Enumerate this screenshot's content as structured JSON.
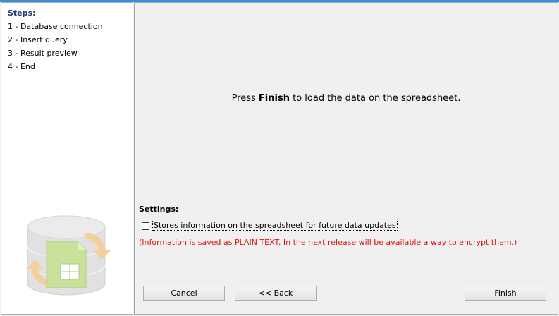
{
  "steps": {
    "title": "Steps:",
    "items": [
      "1 - Database connection",
      "2 - Insert query",
      "3 - Result preview",
      "4 - End"
    ]
  },
  "main": {
    "message_prefix": "Press ",
    "message_bold": "Finish",
    "message_suffix": " to load the data on the spreadsheet."
  },
  "settings": {
    "title": "Settings:",
    "checkbox_label": "Stores information on the spreadsheet for future data updates",
    "checkbox_checked": false,
    "warning": "(Information is saved as PLAIN TEXT. In the next release will be available a way to encrypt them.)",
    "warning_color": "#e01010"
  },
  "buttons": {
    "cancel": "Cancel",
    "back": "<< Back",
    "finish": "Finish"
  },
  "colors": {
    "accent": "#3c8fd6",
    "steps_title": "#1f3b73"
  },
  "icons": {
    "logo": "database-spreadsheet-logo"
  }
}
